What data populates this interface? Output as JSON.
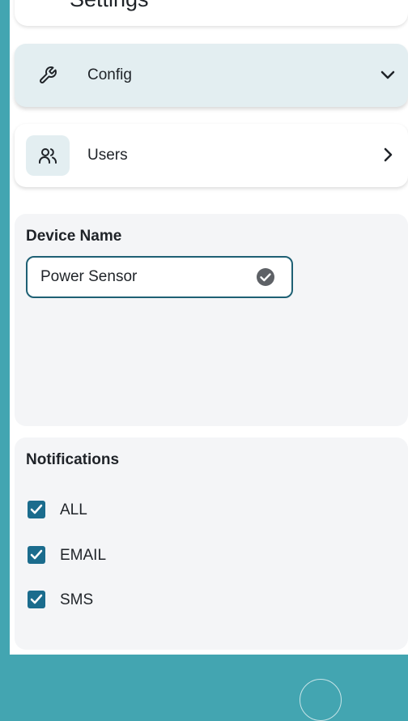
{
  "header": {
    "title": "Settings",
    "icons": {
      "back": "arrow-left-icon",
      "timer": "timer-icon",
      "menu": "hamburger-menu-icon"
    },
    "timer_button_color": "#cdeed8"
  },
  "config_row": {
    "label": "Config",
    "icon": "wrench-icon",
    "chevron": "chevron-down-icon",
    "expanded": true
  },
  "users_row": {
    "label": "Users",
    "icon": "users-icon",
    "chevron": "chevron-right-icon"
  },
  "device": {
    "label": "Device Name",
    "value": "Power Sensor",
    "valid_icon": "check-circle-icon"
  },
  "notifications": {
    "label": "Notifications",
    "options": [
      {
        "label": "ALL",
        "checked": true
      },
      {
        "label": "EMAIL",
        "checked": true
      },
      {
        "label": "SMS",
        "checked": true
      }
    ]
  },
  "colors": {
    "background": "#43a5b1",
    "accent": "#1b6c8d",
    "config_row_bg": "#e3eef1",
    "section_bg": "#f4f5f7"
  }
}
